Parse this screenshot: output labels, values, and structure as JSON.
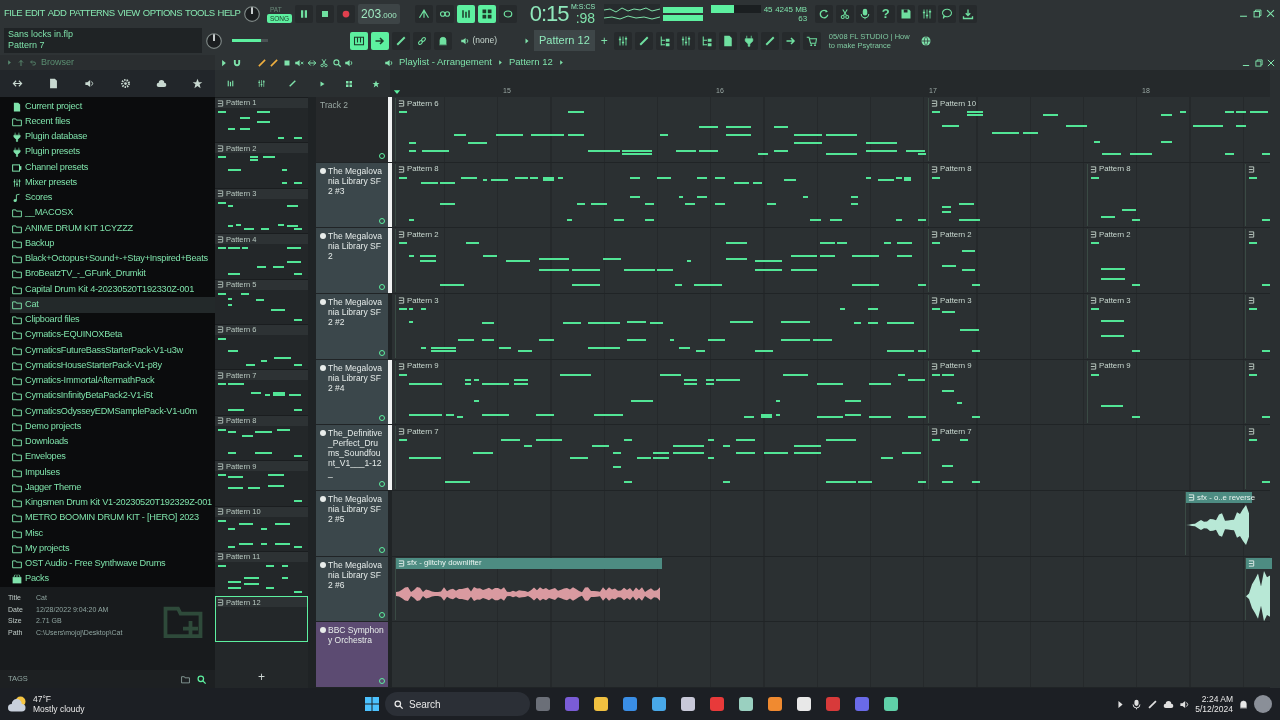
{
  "menu": [
    "FILE",
    "EDIT",
    "ADD",
    "PATTERNS",
    "VIEW",
    "OPTIONS",
    "TOOLS",
    "HELP"
  ],
  "project": {
    "file": "Sans locks in.flp",
    "hint": "Pattern 7"
  },
  "transport": {
    "modes": [
      {
        "label": "PAT",
        "selected": false
      },
      {
        "label": "SONG",
        "selected": true
      }
    ],
    "tempo": "203",
    "tempo_fraction": ".000"
  },
  "snap_tools": [
    {
      "kind": "tent",
      "on": false
    },
    {
      "kind": "tape",
      "on": false
    },
    {
      "kind": "bars",
      "on": true
    },
    {
      "kind": "grid",
      "on": true
    },
    {
      "kind": "loop",
      "on": false
    }
  ],
  "time": {
    "unit": "M:S:CS",
    "value": "0:15",
    "centiseconds": ":98"
  },
  "monitor": {
    "cpu": "45",
    "memory": "4245 MB",
    "polyphony": "63",
    "level": 0.45
  },
  "master_volume": {
    "level": 0.8
  },
  "view_tools": [
    {
      "kind": "piano",
      "on": true
    },
    {
      "kind": "arrow",
      "on": true
    },
    {
      "kind": "pencil",
      "on": false
    },
    {
      "kind": "link",
      "on": false
    },
    {
      "kind": "bell",
      "on": false
    }
  ],
  "pattern_selector": {
    "channel": "(none)",
    "pattern": "Pattern 12",
    "add": "+"
  },
  "help_label": "?",
  "news": {
    "date": "05/08",
    "title": "FL STUDIO | How to make Psytrance"
  },
  "browser": {
    "title": "Browser",
    "items": [
      {
        "label": "Current project",
        "kind": "page",
        "selected": false
      },
      {
        "label": "Recent files",
        "kind": "folder",
        "selected": false
      },
      {
        "label": "Plugin database",
        "kind": "plug",
        "selected": false
      },
      {
        "label": "Plugin presets",
        "kind": "plug",
        "selected": false
      },
      {
        "label": "Channel presets",
        "kind": "channel",
        "selected": false
      },
      {
        "label": "Mixer presets",
        "kind": "sliders",
        "selected": false
      },
      {
        "label": "Scores",
        "kind": "note",
        "selected": false
      },
      {
        "label": "__MACOSX",
        "kind": "folder",
        "selected": false
      },
      {
        "label": "ANIME DRUM KIT 1CYZZZ",
        "kind": "folder",
        "selected": false
      },
      {
        "label": "Backup",
        "kind": "folder",
        "selected": false
      },
      {
        "label": "Black+Octopus+Sound+-+Stay+Inspired+Beats",
        "kind": "folder",
        "selected": false
      },
      {
        "label": "BroBeatzTV_-_GFunk_Drumkit",
        "kind": "folder",
        "selected": false
      },
      {
        "label": "Capital Drum Kit 4-20230520T192330Z-001",
        "kind": "folder",
        "selected": false
      },
      {
        "label": "Cat",
        "kind": "folder",
        "selected": true
      },
      {
        "label": "Clipboard files",
        "kind": "folder",
        "selected": false
      },
      {
        "label": "Cymatics-EQUINOXBeta",
        "kind": "folder",
        "selected": false
      },
      {
        "label": "CymaticsFutureBassStarterPack-V1-u3w",
        "kind": "folder",
        "selected": false
      },
      {
        "label": "CymaticsHouseStarterPack-V1-p8y",
        "kind": "folder",
        "selected": false
      },
      {
        "label": "Cymatics-ImmortalAftermathPack",
        "kind": "folder",
        "selected": false
      },
      {
        "label": "CymaticsInfinityBetaPack2-V1-i5t",
        "kind": "folder",
        "selected": false
      },
      {
        "label": "CymaticsOdysseyEDMSamplePack-V1-u0m",
        "kind": "folder",
        "selected": false
      },
      {
        "label": "Demo projects",
        "kind": "folder",
        "selected": false
      },
      {
        "label": "Downloads",
        "kind": "folder",
        "selected": false
      },
      {
        "label": "Envelopes",
        "kind": "folder",
        "selected": false
      },
      {
        "label": "Impulses",
        "kind": "folder",
        "selected": false
      },
      {
        "label": "Jagger Theme",
        "kind": "folder",
        "selected": false
      },
      {
        "label": "Kingsmen Drum Kit V1-20230520T192329Z-001",
        "kind": "folder",
        "selected": false
      },
      {
        "label": "METRO BOOMIN DRUM KIT - [HERO] 2023",
        "kind": "folder",
        "selected": false
      },
      {
        "label": "Misc",
        "kind": "folder",
        "selected": false
      },
      {
        "label": "My projects",
        "kind": "folder",
        "selected": false
      },
      {
        "label": "OST Audio - Free Synthwave Drums",
        "kind": "folder",
        "selected": false
      },
      {
        "label": "Packs",
        "kind": "packs",
        "selected": false
      }
    ],
    "info": [
      {
        "key": "Title",
        "value": "Cat"
      },
      {
        "key": "Date",
        "value": "12/28/2022 9:04:20 AM"
      },
      {
        "key": "Size",
        "value": "2.71 GB"
      },
      {
        "key": "Path",
        "value": "C:\\Users\\mojoj\\Desktop\\Cat"
      }
    ],
    "tags": "TAGS"
  },
  "playlist": {
    "title": "Playlist - Arrangement",
    "pattern": "Pattern 12",
    "ruler": [
      "15",
      "16",
      "17",
      "18"
    ],
    "picker": [
      {
        "label": "Pattern 1",
        "selected": false
      },
      {
        "label": "Pattern 2",
        "selected": false
      },
      {
        "label": "Pattern 3",
        "selected": false
      },
      {
        "label": "Pattern 4",
        "selected": false
      },
      {
        "label": "Pattern 5",
        "selected": false
      },
      {
        "label": "Pattern 6",
        "selected": false
      },
      {
        "label": "Pattern 7",
        "selected": false
      },
      {
        "label": "Pattern 8",
        "selected": false
      },
      {
        "label": "Pattern 9",
        "selected": false
      },
      {
        "label": "Pattern 10",
        "selected": false
      },
      {
        "label": "Pattern 11",
        "selected": false
      },
      {
        "label": "Pattern 12",
        "selected": true
      }
    ],
    "picker_add": "+",
    "tracks": [
      {
        "name": "Track 2",
        "kind": "track",
        "color": "#26292b",
        "selected": true,
        "clips": [
          {
            "kind": "pattern",
            "label": "Pattern 6"
          },
          {
            "kind": "pattern",
            "label": "Pattern 10"
          }
        ]
      },
      {
        "name": "The Megalovania Library SF2 #3",
        "kind": "instrument",
        "color": "#3b474b",
        "selected": true,
        "clips": [
          {
            "kind": "pattern",
            "label": "Pattern 8"
          },
          {
            "kind": "pattern",
            "label": "Pattern 8"
          },
          {
            "kind": "pattern",
            "label": "Pattern 8"
          },
          {
            "kind": "pattern"
          }
        ]
      },
      {
        "name": "The Megalovania Library SF2",
        "kind": "instrument",
        "color": "#3b474b",
        "selected": true,
        "clips": [
          {
            "kind": "pattern",
            "label": "Pattern 2"
          },
          {
            "kind": "pattern",
            "label": "Pattern 2"
          },
          {
            "kind": "pattern",
            "label": "Pattern 2"
          },
          {
            "kind": "pattern"
          }
        ]
      },
      {
        "name": "The Megalovania Library SF2 #2",
        "kind": "instrument",
        "color": "#3b474b",
        "selected": false,
        "clips": [
          {
            "kind": "pattern",
            "label": "Pattern 3"
          },
          {
            "kind": "pattern",
            "label": "Pattern 3"
          },
          {
            "kind": "pattern",
            "label": "Pattern 3"
          },
          {
            "kind": "pattern"
          }
        ]
      },
      {
        "name": "The Megalovania Library SF2 #4",
        "kind": "instrument",
        "color": "#3b474b",
        "selected": true,
        "clips": [
          {
            "kind": "pattern",
            "label": "Pattern 9"
          },
          {
            "kind": "pattern",
            "label": "Pattern 9"
          },
          {
            "kind": "pattern",
            "label": "Pattern 9"
          },
          {
            "kind": "pattern"
          }
        ]
      },
      {
        "name": "The_Definitive_Perfect_Drums_Soundfount_V1___1-12_",
        "kind": "instrument",
        "color": "#3b474b",
        "selected": true,
        "clips": [
          {
            "kind": "pattern",
            "label": "Pattern 7"
          },
          {
            "kind": "pattern",
            "label": "Pattern 7"
          },
          {
            "kind": "pattern"
          }
        ]
      },
      {
        "name": "The Megalovania Library SF2 #5",
        "kind": "instrument",
        "color": "#3b474b",
        "selected": false,
        "clips": [
          {
            "kind": "audio",
            "label": "sfx - o..e reverse"
          }
        ]
      },
      {
        "name": "The Megalovania Library SF2 #6",
        "kind": "instrument",
        "color": "#3b474b",
        "selected": false,
        "clips": [
          {
            "kind": "audio",
            "label": "sfx - glitchy downlifter"
          },
          {
            "kind": "audio"
          }
        ]
      },
      {
        "name": "BBC Symphony Orchestra",
        "kind": "instrument",
        "color": "#5c4b72",
        "selected": false
      }
    ]
  },
  "taskbar": {
    "temperature": "47°F",
    "weather": "Mostly cloudy",
    "search": "Search",
    "time": "2:24 AM",
    "date": "5/12/2024"
  }
}
